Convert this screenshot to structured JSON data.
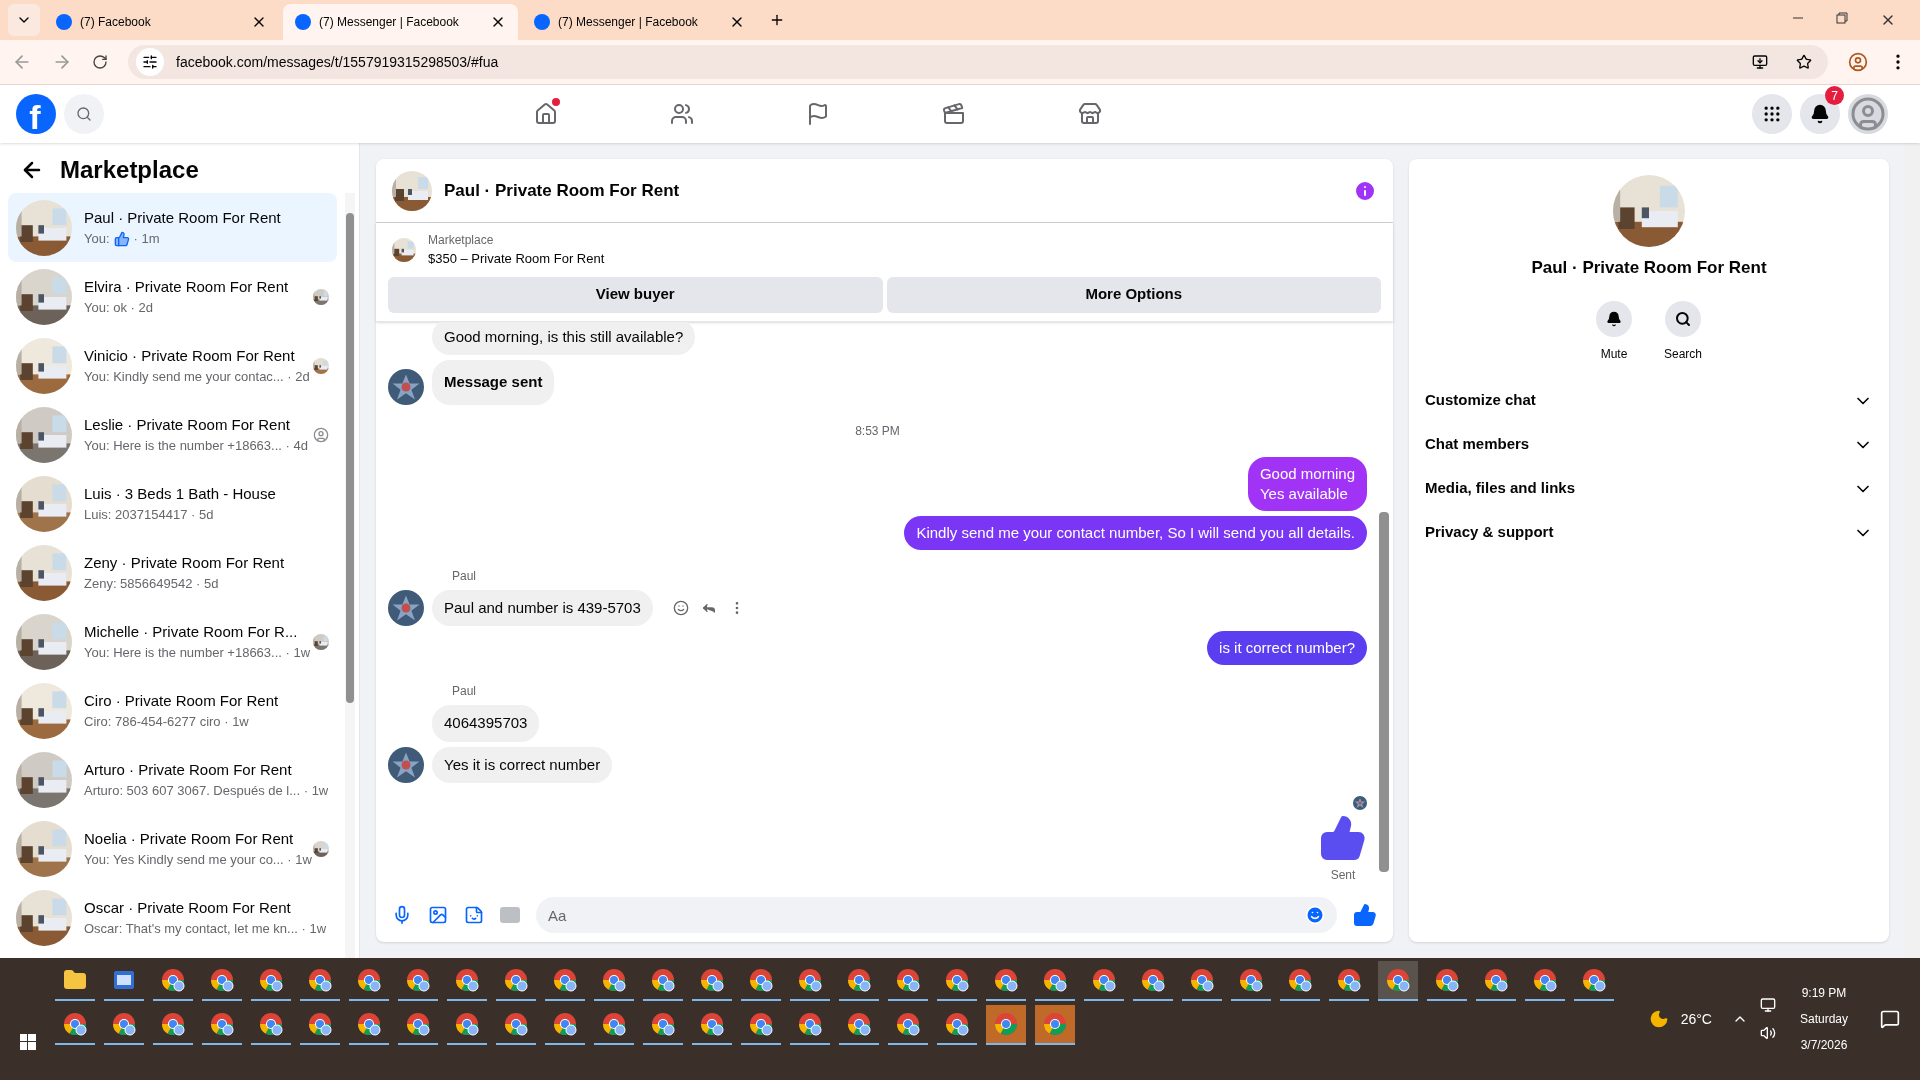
{
  "browser": {
    "tabs": [
      {
        "title": "(7) Facebook",
        "selected": false
      },
      {
        "title": "(7) Messenger | Facebook",
        "selected": true
      },
      {
        "title": "(7) Messenger | Facebook",
        "selected": false
      }
    ],
    "url": "facebook.com/messages/t/1557919315298503/#fua"
  },
  "header": {
    "logo": "f",
    "nav": [
      {
        "kind": "home",
        "dot": true
      },
      {
        "kind": "friends",
        "dot": false
      },
      {
        "kind": "pages",
        "dot": false
      },
      {
        "kind": "video",
        "dot": false
      },
      {
        "kind": "marketplace",
        "dot": false
      }
    ],
    "notification_count": "7"
  },
  "sidebar": {
    "title": "Marketplace",
    "conversations": [
      {
        "title": "Paul · Private Room For Rent",
        "preview": "You:",
        "like": true,
        "preview_end": "· 1m",
        "selected": true
      },
      {
        "title": "Elvira · Private Room For Rent",
        "preview": "You: ok · 2d",
        "selected": false
      },
      {
        "title": "Vinicio · Private Room For Rent",
        "preview": "You: Kindly send me your contac... · 2d",
        "selected": false
      },
      {
        "title": "Leslie · Private Room For Rent",
        "preview": "You: Here is the number +18663... · 4d",
        "selected": false,
        "seen_avatar": {
          "kind": "default"
        }
      },
      {
        "title": "Luis · 3 Beds 1 Bath - House",
        "preview": "Luis: 2037154417 · 5d",
        "selected": false
      },
      {
        "title": "Zeny · Private Room For Rent",
        "preview": "Zeny: 5856649542 · 5d",
        "selected": false
      },
      {
        "title": "Michelle · Private Room For R...",
        "preview": "You: Here is the number +18663... · 1w",
        "selected": false
      },
      {
        "title": "Ciro · Private Room For Rent",
        "preview": "Ciro: 786-454-6277 ciro · 1w",
        "selected": false
      },
      {
        "title": "Arturo · Private Room For Rent",
        "preview": "Arturo: 503 607 3067. Después de l... · 1w",
        "selected": false
      },
      {
        "title": "Noelia · Private Room For Rent",
        "preview": "You: Yes Kindly send me your co... · 1w",
        "selected": false
      },
      {
        "title": "Oscar · Private Room For Rent",
        "preview": "Oscar: That's my contact, let me kn... · 1w",
        "selected": false
      }
    ]
  },
  "chat": {
    "title": "Paul · Private Room For Rent",
    "listing": {
      "source": "Marketplace",
      "name": "$350 – Private Room For Rent"
    },
    "buttons": [
      "View buyer",
      "More Options"
    ],
    "messages": [
      {
        "kind": "incoming",
        "text": "Good morning, is this still available?",
        "avatar": false,
        "bold": false
      },
      {
        "kind": "incoming",
        "text": "Message sent",
        "avatar": true,
        "bold": true
      },
      {
        "kind": "time",
        "text": "8:53 PM"
      },
      {
        "kind": "outgoing",
        "text": "Good morning\nYes available",
        "color": "#a033f6"
      },
      {
        "kind": "outgoing",
        "text": "Kindly send me your contact number, So I will send you all details.",
        "color": "#7a35f5"
      },
      {
        "kind": "sender",
        "text": "Paul"
      },
      {
        "kind": "incoming",
        "text": "Paul and number is 439-5703",
        "avatar": true,
        "bold": false,
        "actions": true
      },
      {
        "kind": "outgoing",
        "text": "is it correct number?",
        "color": "#5b3ef0"
      },
      {
        "kind": "sender",
        "text": "Paul"
      },
      {
        "kind": "incoming",
        "text": "4064395703",
        "avatar": false,
        "bold": false
      },
      {
        "kind": "incoming",
        "text": "Yes it is correct number",
        "avatar": true,
        "bold": false
      },
      {
        "kind": "like",
        "status": "Sent"
      }
    ],
    "composer": {
      "placeholder": "Aa"
    }
  },
  "details": {
    "title": "Paul · Private Room For Rent",
    "actions": [
      {
        "kind": "mute",
        "label": "Mute"
      },
      {
        "kind": "search",
        "label": "Search"
      }
    ],
    "sections": [
      {
        "label": "Customize chat",
        "expanded": false
      },
      {
        "label": "Chat members",
        "expanded": false
      },
      {
        "label": "Media, files and links",
        "expanded": false
      },
      {
        "label": "Privacy & support",
        "expanded": false
      }
    ]
  },
  "taskbar": {
    "row_1": [
      {
        "kind": "folder",
        "selected": false
      },
      {
        "kind": "app",
        "selected": false
      },
      {
        "kind": "profile",
        "selected": false
      },
      {
        "kind": "profile",
        "selected": false
      },
      {
        "kind": "profile",
        "selected": false
      },
      {
        "kind": "profile",
        "selected": false
      },
      {
        "kind": "profile",
        "selected": false
      },
      {
        "kind": "profile",
        "selected": false
      },
      {
        "kind": "profile",
        "selected": false
      },
      {
        "kind": "profile",
        "selected": false
      },
      {
        "kind": "profile",
        "selected": false
      },
      {
        "kind": "profile",
        "selected": false
      },
      {
        "kind": "profile",
        "selected": false
      },
      {
        "kind": "profile",
        "selected": false
      },
      {
        "kind": "profile",
        "selected": false
      },
      {
        "kind": "profile",
        "selected": false
      },
      {
        "kind": "profile",
        "selected": false
      },
      {
        "kind": "profile",
        "selected": false
      },
      {
        "kind": "profile",
        "selected": false
      },
      {
        "kind": "profile",
        "selected": false
      },
      {
        "kind": "profile",
        "selected": false
      },
      {
        "kind": "profile",
        "selected": false
      },
      {
        "kind": "profile",
        "selected": false
      },
      {
        "kind": "profile",
        "selected": false
      },
      {
        "kind": "profile",
        "selected": false
      },
      {
        "kind": "profile",
        "selected": false
      },
      {
        "kind": "profile",
        "selected": false
      },
      {
        "kind": "profile",
        "selected": true
      },
      {
        "kind": "profile",
        "selected": false
      },
      {
        "kind": "profile",
        "selected": false
      },
      {
        "kind": "profile",
        "selected": false
      },
      {
        "kind": "profile",
        "selected": false
      }
    ],
    "row_2": [
      {
        "kind": "profile",
        "selected": false
      },
      {
        "kind": "profile",
        "selected": false
      },
      {
        "kind": "profile",
        "selected": false
      },
      {
        "kind": "profile",
        "selected": false
      },
      {
        "kind": "profile",
        "selected": false
      },
      {
        "kind": "profile",
        "selected": false
      },
      {
        "kind": "profile",
        "selected": false
      },
      {
        "kind": "profile",
        "selected": false
      },
      {
        "kind": "profile",
        "selected": false
      },
      {
        "kind": "profile",
        "selected": false
      },
      {
        "kind": "profile",
        "selected": false
      },
      {
        "kind": "profile",
        "selected": false
      },
      {
        "kind": "profile",
        "selected": false
      },
      {
        "kind": "profile",
        "selected": false
      },
      {
        "kind": "profile",
        "selected": false
      },
      {
        "kind": "profile",
        "selected": false
      },
      {
        "kind": "profile",
        "selected": false
      },
      {
        "kind": "profile",
        "selected": false
      },
      {
        "kind": "profile",
        "selected": false
      },
      {
        "kind": "browser",
        "selected": true
      },
      {
        "kind": "browser",
        "selected": true
      }
    ],
    "weather": "26°C",
    "time": "9:19 PM",
    "day": "Saturday",
    "date": "3/7/2026"
  }
}
